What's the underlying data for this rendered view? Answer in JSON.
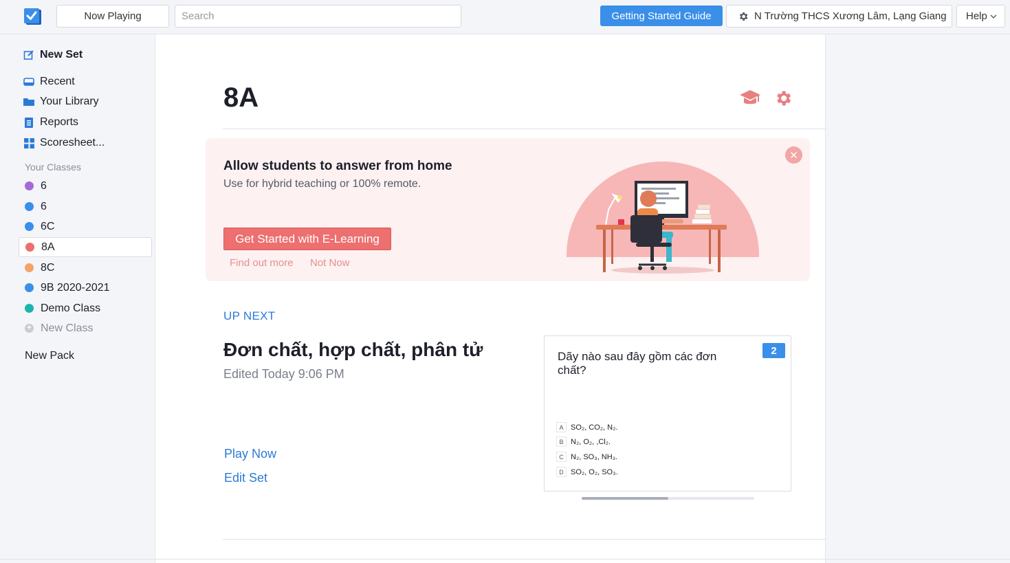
{
  "topbar": {
    "now_playing": "Now Playing",
    "search_placeholder": "Search",
    "guide_label": "Getting Started Guide",
    "school_label": "N Trường THCS Xương Lâm, Lạng Giang",
    "help_label": "Help"
  },
  "sidebar": {
    "new_set": "New Set",
    "nav": [
      {
        "label": "Recent",
        "icon": "recent-icon"
      },
      {
        "label": "Your Library",
        "icon": "folder-icon"
      },
      {
        "label": "Reports",
        "icon": "reports-icon"
      },
      {
        "label": "Scoresheet...",
        "icon": "scoresheet-icon"
      }
    ],
    "classes_heading": "Your Classes",
    "classes": [
      {
        "label": "6",
        "color": "#a56ad6"
      },
      {
        "label": "6",
        "color": "#3a8fe8"
      },
      {
        "label": "6C",
        "color": "#3a8fe8"
      },
      {
        "label": "8A",
        "color": "#ed6f6f",
        "active": true
      },
      {
        "label": "8C",
        "color": "#f4a36a"
      },
      {
        "label": "9B 2020-2021",
        "color": "#3a8fe8"
      },
      {
        "label": "Demo Class",
        "color": "#1bb5b0"
      }
    ],
    "new_class": "New Class",
    "new_pack": "New Pack"
  },
  "main": {
    "class_title": "8A",
    "banner": {
      "title": "Allow students to answer from home",
      "subtitle": "Use for hybrid teaching or 100% remote.",
      "cta": "Get Started with E-Learning",
      "find_out_more": "Find out more",
      "not_now": "Not Now"
    },
    "up_next_label": "UP NEXT",
    "set_title": "Đơn chất, hợp chất, phân tử",
    "edited": "Edited Today 9:06 PM",
    "play_now": "Play Now",
    "edit_set": "Edit Set",
    "slide": {
      "question": "Dãy nào sau đây gồm các đơn chất?",
      "number": "2",
      "options": [
        {
          "letter": "A",
          "text": "SO₂, CO₂, N₂."
        },
        {
          "letter": "B",
          "text": "N₂, O₂, ,Cl₂."
        },
        {
          "letter": "C",
          "text": "N₂, SO₃, NH₃."
        },
        {
          "letter": "D",
          "text": "SO₂, O₂, SO₃."
        }
      ],
      "carousel_progress": 0.5
    }
  },
  "colors": {
    "accent": "#3a8fe8",
    "brand_red": "#ed6f6f",
    "link_blue": "#2b7bd6"
  }
}
